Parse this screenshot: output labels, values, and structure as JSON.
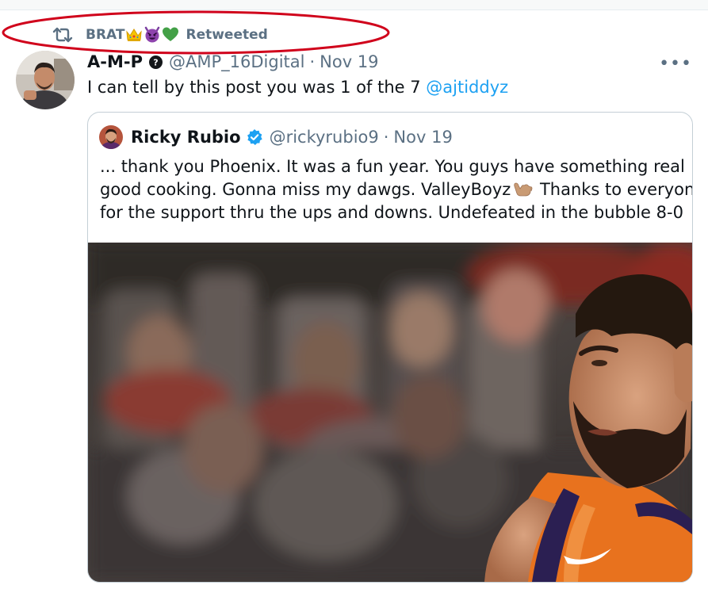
{
  "retweet": {
    "user": "BRAT",
    "emojis": [
      "crown-emoji",
      "smiling-devil-emoji",
      "green-heart-emoji"
    ],
    "label": "Retweeted"
  },
  "tweet": {
    "name": "A-M-P",
    "handle": "@AMP_16Digital",
    "separator": "·",
    "date": "Nov 19",
    "more": "•••",
    "text": "I can tell by this post you was 1 of the 7 ",
    "mention": "@ajtiddyz"
  },
  "quoted": {
    "name": "Ricky Rubio",
    "handle": "@rickyrubio9",
    "separator": "·",
    "date": "Nov 19",
    "line1": "... thank you Phoenix. It was a fun year. You guys have something real",
    "line2a": "good cooking. Gonna miss my dawgs. ValleyBoyz",
    "line2b": " Thanks to everyone",
    "line3": "for the support thru the ups and downs. Undefeated in the bubble 8-0",
    "media_description": "Basketball player in orange Phoenix jersey with blurred crowd background"
  },
  "colors": {
    "accent": "#1da1f2",
    "muted": "#5b7083",
    "text": "#0f1419",
    "annotation": "#d0021b"
  }
}
